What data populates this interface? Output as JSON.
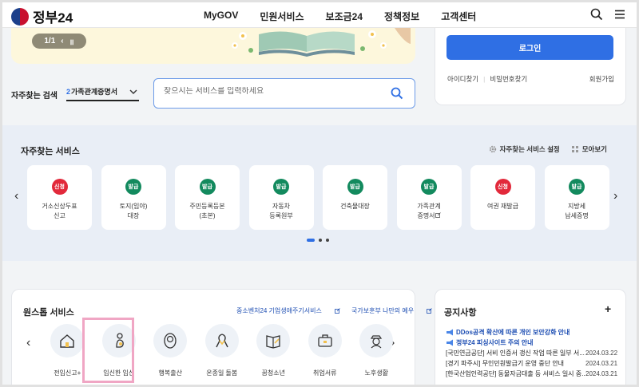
{
  "header": {
    "logo_text": "정부24",
    "nav": [
      "MyGOV",
      "민원서비스",
      "보조금24",
      "정책정보",
      "고객센터"
    ],
    "icons": [
      "search-icon",
      "menu-icon"
    ]
  },
  "hero": {
    "pager_text": "1/1"
  },
  "login": {
    "button_label": "로그인",
    "find_id": "아이디찾기",
    "find_pw": "비밀번호찾기",
    "join": "회원가입"
  },
  "search": {
    "label": "자주찾는 검색",
    "selected_num": "2",
    "selected_text": "가족관계증명서",
    "placeholder": "찾으시는 서비스를 입력하세요"
  },
  "frequent": {
    "title": "자주찾는 서비스",
    "settings_label": "자주찾는 서비스 설정",
    "viewall_label": "모아보기",
    "cards": [
      {
        "badge": "신청",
        "badge_color": "#e2293b",
        "line1": "거소신상두표",
        "line2": "신고"
      },
      {
        "badge": "발급",
        "badge_color": "#138a5e",
        "line1": "토지(임야)",
        "line2": "대장"
      },
      {
        "badge": "발급",
        "badge_color": "#138a5e",
        "line1": "주민등록등본",
        "line2": "(초본)"
      },
      {
        "badge": "발급",
        "badge_color": "#138a5e",
        "line1": "자동차",
        "line2": "등록원부"
      },
      {
        "badge": "발급",
        "badge_color": "#138a5e",
        "line1": "건축물대장",
        "line2": ""
      },
      {
        "badge": "발급",
        "badge_color": "#138a5e",
        "line1": "가족관계",
        "line2": "증명서"
      },
      {
        "badge": "신청",
        "badge_color": "#e2293b",
        "line1": "여권 재발급",
        "line2": ""
      },
      {
        "badge": "발급",
        "badge_color": "#138a5e",
        "line1": "지방세",
        "line2": "납세증명"
      }
    ]
  },
  "onestop": {
    "title": "원스톱 서비스",
    "link1": "중소벤처24 기업생애주기서비스",
    "link2": "국가보훈부 나만의 예우",
    "items": [
      {
        "label": "전입신고+",
        "icon": "house-icon"
      },
      {
        "label": "임신한 임신",
        "icon": "pregnancy-icon"
      },
      {
        "label": "행복출산",
        "icon": "baby-icon"
      },
      {
        "label": "온종일 돌봄",
        "icon": "ribbon-icon"
      },
      {
        "label": "꿈청소년",
        "icon": "book-icon"
      },
      {
        "label": "취업서류",
        "icon": "briefcase-icon"
      },
      {
        "label": "노후생활",
        "icon": "elder-icon"
      }
    ]
  },
  "notice": {
    "title": "공지사항",
    "more": "+",
    "rows": [
      {
        "text": "DDos공격 확산에 따른 개인 보안강화 안내",
        "date": "",
        "hot": true
      },
      {
        "text": "정부24 피싱사이트 주의 안내",
        "date": "",
        "hot": true
      },
      {
        "text": "[국민연금공단] 서비 인증서 갱신 작업 따른 일부 서...",
        "date": "2024.03.22",
        "hot": false
      },
      {
        "text": "[경기 파주시] 무인민원발급기 운영 중단 안내",
        "date": "2024.03.21",
        "hot": false
      },
      {
        "text": "[한국산업인력공단] 동물자금대출 등 서비스 일시 중...",
        "date": "2024.03.21",
        "hot": false
      }
    ]
  },
  "colors": {
    "accent": "#2f6fe4",
    "badge_green": "#138a5e",
    "badge_red": "#e2293b",
    "highlight": "#f0a6c4"
  }
}
